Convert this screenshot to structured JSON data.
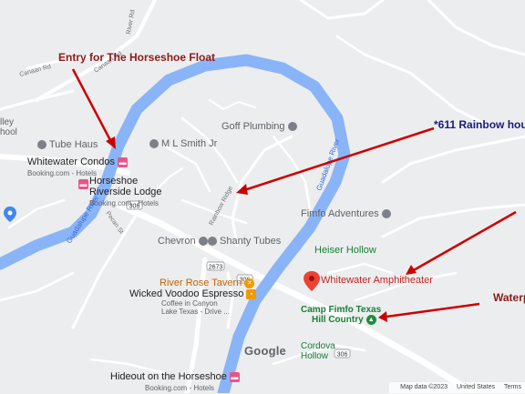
{
  "annotations": {
    "entry": "Entry for The Horseshoe Float",
    "rainbow": "*611 Rainbow hous",
    "waterpark": "Waterp"
  },
  "roads": {
    "canaan_rd_1": "Canaan Rd",
    "canaan_rd_2": "Canaan Rd",
    "river_rd": "River Rd",
    "pecan_st": "Pecan St",
    "rainbow_ridge": "Rainbow Ridge",
    "guadalupe_river_1": "Guadalupe River",
    "guadalupe_river_2": "Guadalupe River",
    "route_306a": "306",
    "route_2673": "2673",
    "route_306b": "306",
    "route_306c": "306"
  },
  "places": {
    "valley_partial_1": "lley",
    "valley_partial_2": "hool",
    "tube_haus": "Tube Haus",
    "whitewater_condos": "Whitewater Condos",
    "whitewater_condos_sub": "Booking.com - Hotels",
    "horseshoe_lodge_1": "Horseshoe",
    "horseshoe_lodge_2": "Riverside Lodge",
    "horseshoe_lodge_sub": "Booking.com - Hotels",
    "ml_smith": "M L Smith Jr",
    "goff_plumbing": "Goff Plumbing",
    "fimfo_adventures": "Fimfo Adventures",
    "heiser_hollow": "Heiser Hollow",
    "chevron": "Chevron",
    "shanty_tubes": "Shanty Tubes",
    "whitewater_amphitheater": "Whitewater Amphitheater",
    "river_rose_tavern": "River Rose Tavern",
    "wicked_voodoo": "Wicked Voodoo Espresso",
    "wicked_voodoo_sub1": "Coffee in Canyon",
    "wicked_voodoo_sub2": "Lake Texas - Drive ...",
    "camp_fimfo_1": "Camp Fimfo Texas",
    "camp_fimfo_2": "Hill Country",
    "cordova_hollow_1": "Cordova",
    "cordova_hollow_2": "Hollow",
    "hideout": "Hideout on the Horseshoe",
    "hideout_sub": "Booking.com - Hotels"
  },
  "branding": {
    "logo": "Google"
  },
  "footer": {
    "map_data": "Map data ©2023",
    "country": "United States",
    "terms": "Terms"
  },
  "colors": {
    "land": "#ecedee",
    "river": "#8ab4f8",
    "road": "#ffffff",
    "annotation_red": "#8b1a1a",
    "annotation_navy": "#1a1a7a",
    "arrow": "#cc0000",
    "amphitheater_pin": "#ea4335",
    "camp_label": "#188038",
    "tavern_label": "#c26401"
  }
}
